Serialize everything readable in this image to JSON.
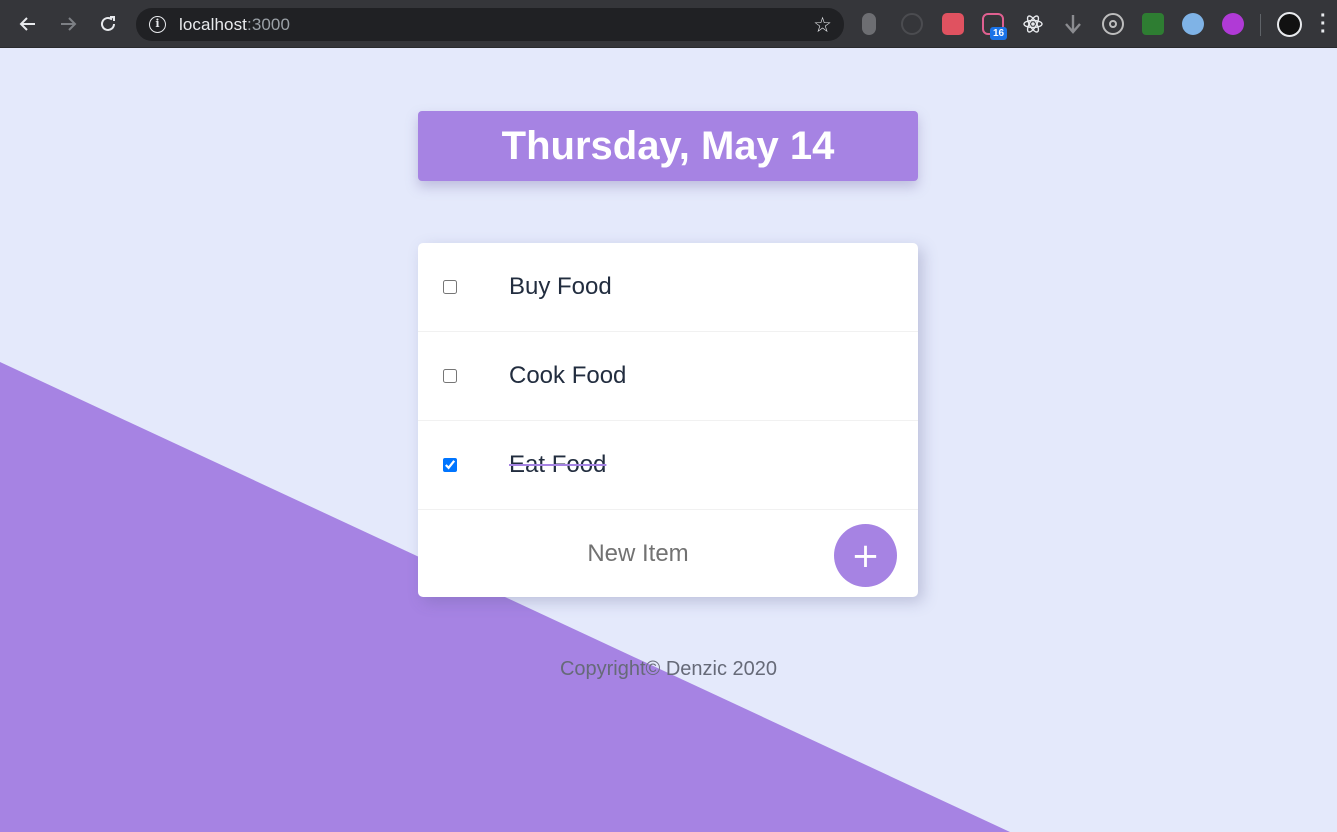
{
  "browser": {
    "url_host": "localhost",
    "url_port": ":3000",
    "extension_badge": "16"
  },
  "app": {
    "heading": "Thursday, May 14",
    "items": [
      {
        "label": "Buy Food",
        "checked": false
      },
      {
        "label": "Cook Food",
        "checked": false
      },
      {
        "label": "Eat Food",
        "checked": true
      }
    ],
    "new_item_placeholder": "New Item",
    "add_button_label": "+",
    "footer": "Copyright© Denzic 2020"
  },
  "colors": {
    "accent": "#a683e3",
    "background": "#e4e9fb",
    "text": "#222d3f"
  }
}
